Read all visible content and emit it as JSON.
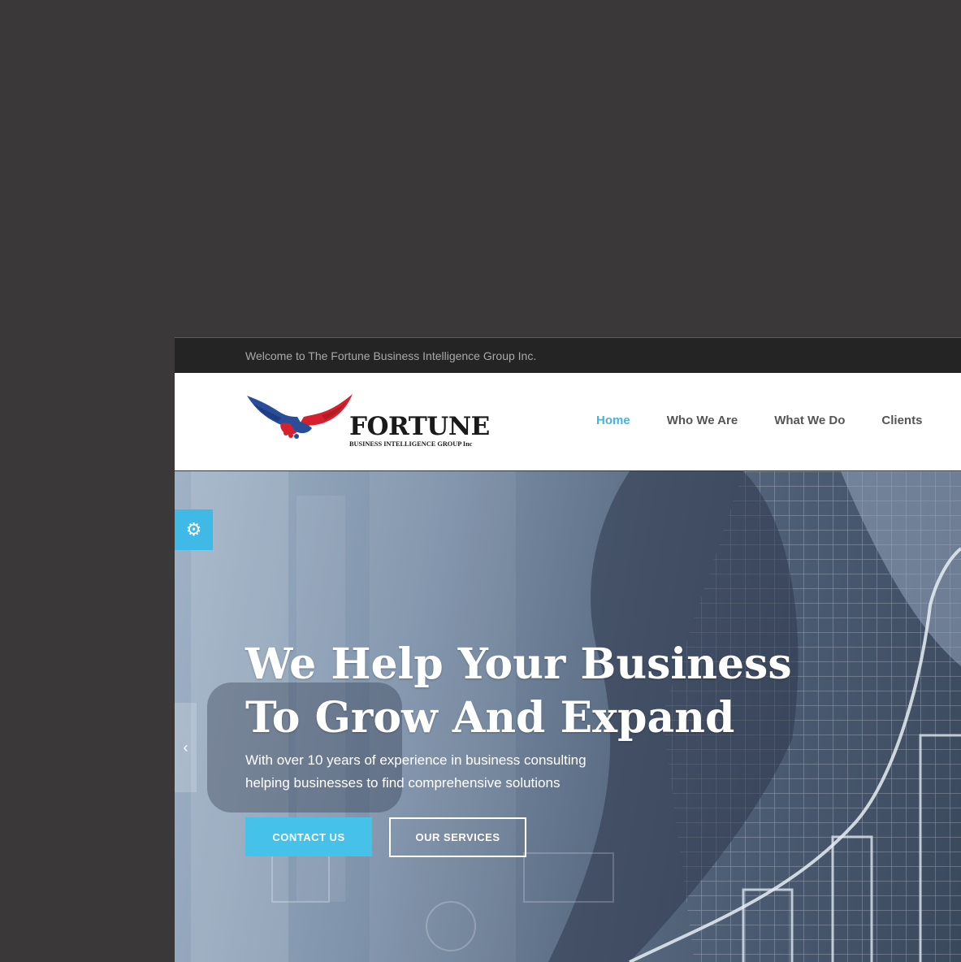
{
  "topbar": {
    "welcome_text": "Welcome to The Fortune Business Intelligence Group Inc."
  },
  "logo": {
    "name": "FORTUNE",
    "tagline": "BUSINESS INTELLIGENCE GROUP Inc"
  },
  "nav": {
    "items": [
      {
        "label": "Home",
        "active": true
      },
      {
        "label": "Who We Are",
        "active": false
      },
      {
        "label": "What We Do",
        "active": false
      },
      {
        "label": "Clients",
        "active": false
      }
    ]
  },
  "hero": {
    "headline_line1": "We Help Your Business",
    "headline_line2": "To Grow And Expand",
    "sub_line1": "With over 10 years of experience in business consulting",
    "sub_line2": "helping businesses to find comprehensive solutions",
    "contact_label": "CONTACT US",
    "services_label": "OUR SERVICES"
  },
  "icons": {
    "settings": "gear-icon",
    "prev": "chevron-left-icon"
  },
  "colors": {
    "accent": "#3fb9e6",
    "topbar_bg": "#242424",
    "page_bg": "#3a3839"
  }
}
